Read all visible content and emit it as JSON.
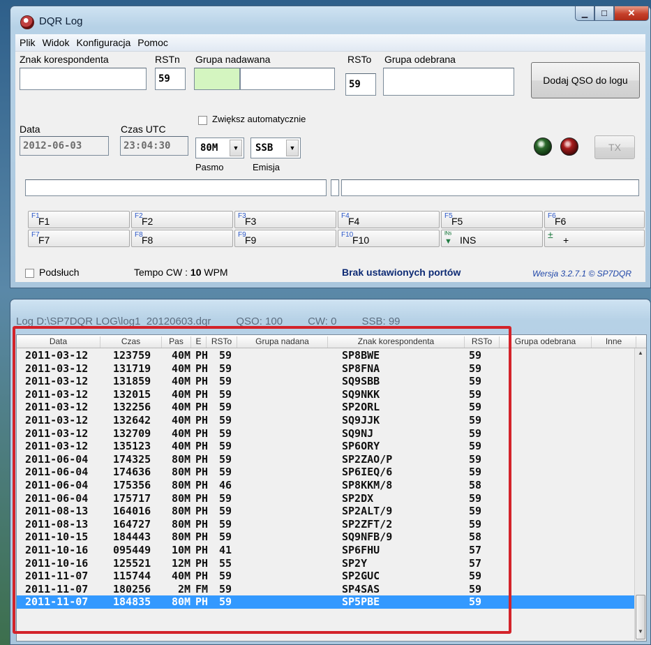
{
  "window": {
    "title": "DQR Log",
    "menu": [
      "Plik",
      "Widok",
      "Konfiguracja",
      "Pomoc"
    ]
  },
  "form": {
    "callsign_label": "Znak korespondenta",
    "callsign_value": "",
    "rstn_label": "RSTn",
    "rstn_value": "59",
    "sent_group_label": "Grupa nadawana",
    "sent_group_value": "",
    "rsto_label": "RSTo",
    "rsto_value": "59",
    "recv_group_label": "Grupa odebrana",
    "recv_group_value": "",
    "auto_increment_label": "Zwiększ automatycznie",
    "date_label": "Data",
    "date_value": "2012-06-03",
    "time_label": "Czas UTC",
    "time_value": "23:04:30",
    "band_value": "80M",
    "band_label": "Pasmo",
    "mode_value": "SSB",
    "mode_label": "Emisja",
    "add_button": "Dodaj QSO do logu",
    "tx_button": "TX"
  },
  "fkeys": [
    {
      "sup": "F1",
      "label": "F1"
    },
    {
      "sup": "F2",
      "label": "F2"
    },
    {
      "sup": "F3",
      "label": "F3"
    },
    {
      "sup": "F4",
      "label": "F4"
    },
    {
      "sup": "F5",
      "label": "F5"
    },
    {
      "sup": "F6",
      "label": "F6"
    },
    {
      "sup": "F7",
      "label": "F7"
    },
    {
      "sup": "F8",
      "label": "F8"
    },
    {
      "sup": "F9",
      "label": "F9"
    },
    {
      "sup": "F10",
      "label": "F10"
    },
    {
      "sup": "INS",
      "label": "INS"
    },
    {
      "sup": "+",
      "label": "+"
    }
  ],
  "status": {
    "monitor_label": "Podsłuch",
    "cw_speed_prefix": "Tempo CW : ",
    "cw_speed_value": "10",
    "cw_speed_unit": " WPM",
    "ports_message": "Brak ustawionych portów",
    "version": "Wersja 3.2.7.1 © SP7DQR"
  },
  "log": {
    "path": "Log D:\\SP7DQR LOG\\log1_20120603.dqr",
    "qso": "QSO:   100",
    "cw": "CW:   0",
    "ssb": "SSB:  99",
    "columns": [
      "Data",
      "Czas",
      "Pas",
      "E",
      "RSTo",
      "Grupa nadana",
      "Znak korespondenta",
      "RSTo",
      "Grupa odebrana",
      "Inne"
    ],
    "rows": [
      {
        "date": "2011-03-12",
        "time": "123759",
        "band": "40M",
        "mode": "PH",
        "rst_s": "59",
        "call": "SP8BWE",
        "rst_r": "59"
      },
      {
        "date": "2011-03-12",
        "time": "131719",
        "band": "40M",
        "mode": "PH",
        "rst_s": "59",
        "call": "SP8FNA",
        "rst_r": "59"
      },
      {
        "date": "2011-03-12",
        "time": "131859",
        "band": "40M",
        "mode": "PH",
        "rst_s": "59",
        "call": "SQ9SBB",
        "rst_r": "59"
      },
      {
        "date": "2011-03-12",
        "time": "132015",
        "band": "40M",
        "mode": "PH",
        "rst_s": "59",
        "call": "SQ9NKK",
        "rst_r": "59"
      },
      {
        "date": "2011-03-12",
        "time": "132256",
        "band": "40M",
        "mode": "PH",
        "rst_s": "59",
        "call": "SP2ORL",
        "rst_r": "59"
      },
      {
        "date": "2011-03-12",
        "time": "132642",
        "band": "40M",
        "mode": "PH",
        "rst_s": "59",
        "call": "SQ9JJK",
        "rst_r": "59"
      },
      {
        "date": "2011-03-12",
        "time": "132709",
        "band": "40M",
        "mode": "PH",
        "rst_s": "59",
        "call": "SQ9NJ",
        "rst_r": "59"
      },
      {
        "date": "2011-03-12",
        "time": "135123",
        "band": "40M",
        "mode": "PH",
        "rst_s": "59",
        "call": "SP6ORY",
        "rst_r": "59"
      },
      {
        "date": "2011-06-04",
        "time": "174325",
        "band": "80M",
        "mode": "PH",
        "rst_s": "59",
        "call": "SP2ZAO/P",
        "rst_r": "59"
      },
      {
        "date": "2011-06-04",
        "time": "174636",
        "band": "80M",
        "mode": "PH",
        "rst_s": "59",
        "call": "SP6IEQ/6",
        "rst_r": "59"
      },
      {
        "date": "2011-06-04",
        "time": "175356",
        "band": "80M",
        "mode": "PH",
        "rst_s": "46",
        "call": "SP8KKM/8",
        "rst_r": "58"
      },
      {
        "date": "2011-06-04",
        "time": "175717",
        "band": "80M",
        "mode": "PH",
        "rst_s": "59",
        "call": "SP2DX",
        "rst_r": "59"
      },
      {
        "date": "2011-08-13",
        "time": "164016",
        "band": "80M",
        "mode": "PH",
        "rst_s": "59",
        "call": "SP2ALT/9",
        "rst_r": "59"
      },
      {
        "date": "2011-08-13",
        "time": "164727",
        "band": "80M",
        "mode": "PH",
        "rst_s": "59",
        "call": "SP2ZFT/2",
        "rst_r": "59"
      },
      {
        "date": "2011-10-15",
        "time": "184443",
        "band": "80M",
        "mode": "PH",
        "rst_s": "59",
        "call": "SQ9NFB/9",
        "rst_r": "58"
      },
      {
        "date": "2011-10-16",
        "time": "095449",
        "band": "10M",
        "mode": "PH",
        "rst_s": "41",
        "call": "SP6FHU",
        "rst_r": "57"
      },
      {
        "date": "2011-10-16",
        "time": "125521",
        "band": "12M",
        "mode": "PH",
        "rst_s": "55",
        "call": "SP2Y",
        "rst_r": "57"
      },
      {
        "date": "2011-11-07",
        "time": "115744",
        "band": "40M",
        "mode": "PH",
        "rst_s": "59",
        "call": "SP2GUC",
        "rst_r": "59"
      },
      {
        "date": "2011-11-07",
        "time": "180256",
        "band": "2M",
        "mode": "FM",
        "rst_s": "59",
        "call": "SP4SAS",
        "rst_r": "59"
      },
      {
        "date": "2011-11-07",
        "time": "184835",
        "band": "80M",
        "mode": "PH",
        "rst_s": "59",
        "call": "SP5PBE",
        "rst_r": "59",
        "selected": true
      }
    ]
  },
  "colors": {
    "highlight": "#3399ff",
    "annotation_frame": "#d3232a",
    "sent_group_fill": "#d4f5c0"
  }
}
